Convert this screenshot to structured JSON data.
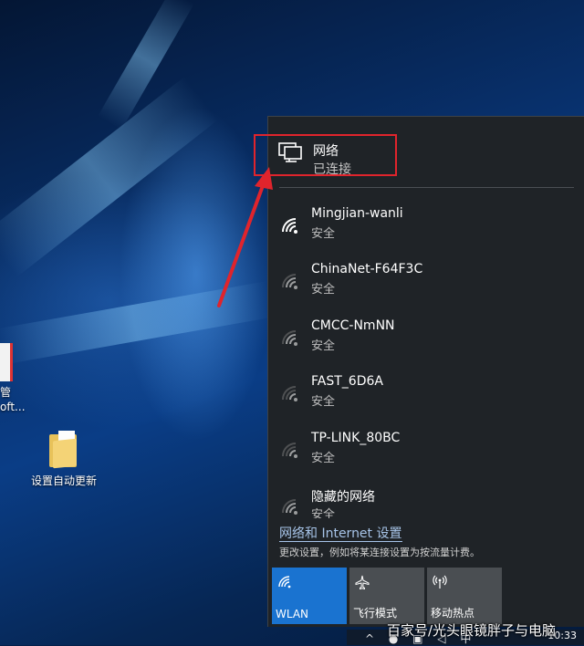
{
  "desktop": {
    "icons": [
      {
        "label_line1": "管",
        "label_line2": "oft..."
      },
      {
        "label": "设置自动更新"
      }
    ]
  },
  "network_panel": {
    "header": {
      "title": "网络",
      "status": "已连接"
    },
    "wifi_list": [
      {
        "ssid": "Mingjian-wanli",
        "security": "安全"
      },
      {
        "ssid": "ChinaNet-F64F3C",
        "security": "安全"
      },
      {
        "ssid": "CMCC-NmNN",
        "security": "安全"
      },
      {
        "ssid": "FAST_6D6A",
        "security": "安全"
      },
      {
        "ssid": "TP-LINK_80BC",
        "security": "安全"
      },
      {
        "ssid": "隐藏的网络",
        "security": "安全"
      }
    ],
    "settings_link": "网络和 Internet 设置",
    "settings_desc": "更改设置，例如将某连接设置为按流量计费。",
    "tiles": [
      {
        "label": "WLAN",
        "icon": "wifi-icon",
        "active": true
      },
      {
        "label": "飞行模式",
        "icon": "airplane-icon",
        "active": false
      },
      {
        "label": "移动热点",
        "icon": "hotspot-icon",
        "active": false
      }
    ]
  },
  "taskbar": {
    "clock": "10:33",
    "ime": "中"
  },
  "watermark": "百家号/光头眼镜胖子与电脑",
  "colors": {
    "accent": "#1a73d0",
    "highlight_box": "#e0242c",
    "panel_bg": "#1f2327"
  }
}
